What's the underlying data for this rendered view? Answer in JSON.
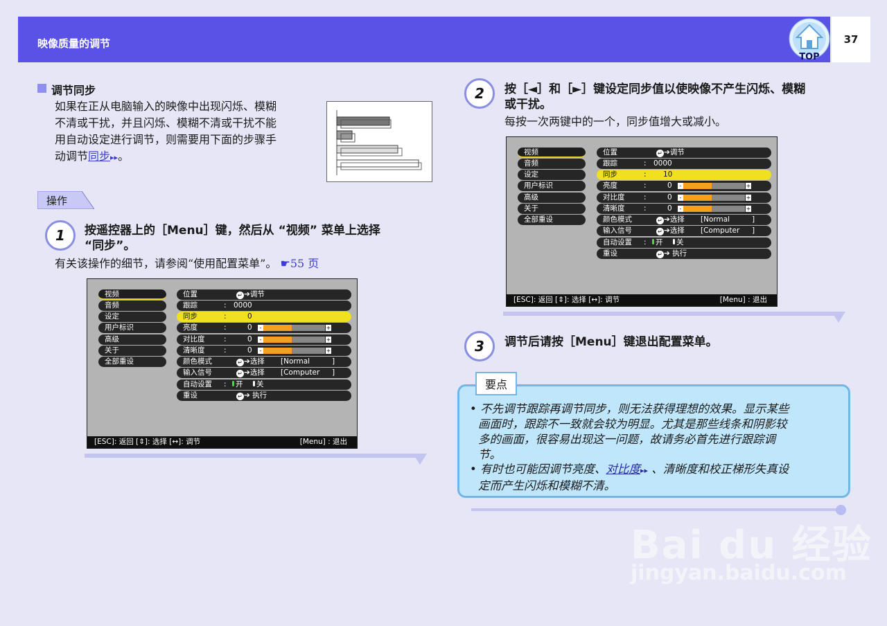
{
  "header": {
    "title": "映像质量的调节",
    "page_number": "37",
    "top_label": "TOP"
  },
  "section": {
    "title": "调节同步",
    "intro": [
      "如果在正从电脑输入的映像中出现闪烁、模糊",
      "不清或干扰，并且闪烁、模糊不清或干扰不能",
      "用自动设定进行调节，则需要用下面的步骤手",
      "动调节"
    ],
    "intro_link": "同步",
    "intro_end": "。"
  },
  "operation_label": "操作",
  "steps": [
    {
      "number": "1",
      "title_line1": "按遥控器上的［Menu］键，然后从 “视频” 菜单上选择",
      "title_line2": "“同步”。",
      "body": "有关该操作的细节，请参阅“使用配置菜单”。",
      "ref": "☛55 页"
    },
    {
      "number": "2",
      "title_line1": "按［◄］和［►］键设定同步值以使映像不产生闪烁、模糊",
      "title_line2": "或干扰。",
      "body": "每按一次两键中的一个，同步值增大或减小。"
    },
    {
      "number": "3",
      "title_line1": "调节后请按［Menu］键退出配置菜单。"
    }
  ],
  "menu": {
    "left_items": [
      "视频",
      "音频",
      "设定",
      "用户标识",
      "高级",
      "关于",
      "全部重设"
    ],
    "rows": {
      "position": {
        "label": "位置",
        "value": "调节"
      },
      "tracking": {
        "label": "跟踪",
        "sep": ":",
        "value": "0000"
      },
      "sync": {
        "label": "同步",
        "sep": ":"
      },
      "brightness": {
        "label": "亮度",
        "sep": ":",
        "value": "0",
        "level": 0.5
      },
      "contrast": {
        "label": "对比度",
        "sep": ":",
        "value": "0",
        "level": 0.5
      },
      "sharpness": {
        "label": "清晰度",
        "sep": ":",
        "value": "0",
        "level": 0.5
      },
      "color_mode": {
        "label": "颜色模式",
        "action": "选择",
        "value": "[Normal",
        "close": "]"
      },
      "input_signal": {
        "label": "输入信号",
        "action": "选择",
        "value": "[Computer",
        "close": "]"
      },
      "auto_setup": {
        "label": "自动设置",
        "sep": ":",
        "on": "开",
        "off": "关"
      },
      "reset": {
        "label": "重设",
        "value": "执行"
      }
    },
    "status_left": "[ESC]: 返回  [⇕]: 选择  [↔]: 调节",
    "status_right": "[Menu] : 退出",
    "sync_value_step1": "0",
    "sync_value_step2": "10"
  },
  "note": {
    "label": "要点",
    "items": [
      {
        "lines": [
          "• 不先调节跟踪再调节同步，则无法获得理想的效果。显示某些",
          "画面时，跟踪不一致就会较为明显。尤其是那些线条和阴影较",
          "多的画面，很容易出现这一问题，故请务必首先进行跟踪调",
          "节。"
        ]
      },
      {
        "prefix": "• 有时也可能因调节亮度、",
        "link": "对比度",
        "suffix": " 、清晰度和校正梯形失真设",
        "line2": "定而产生闪烁和模糊不清。"
      }
    ]
  },
  "watermark": {
    "brand": "Bai du 经验",
    "url": "jingyan.baidu.com"
  },
  "colors": {
    "header": "#5a52e6",
    "accent": "#8f8ff0",
    "note_bg": "#bfe6fa",
    "note_border": "#70b6e6",
    "menu_highlight": "#f0e020",
    "slider_fill": "#f6a020"
  }
}
